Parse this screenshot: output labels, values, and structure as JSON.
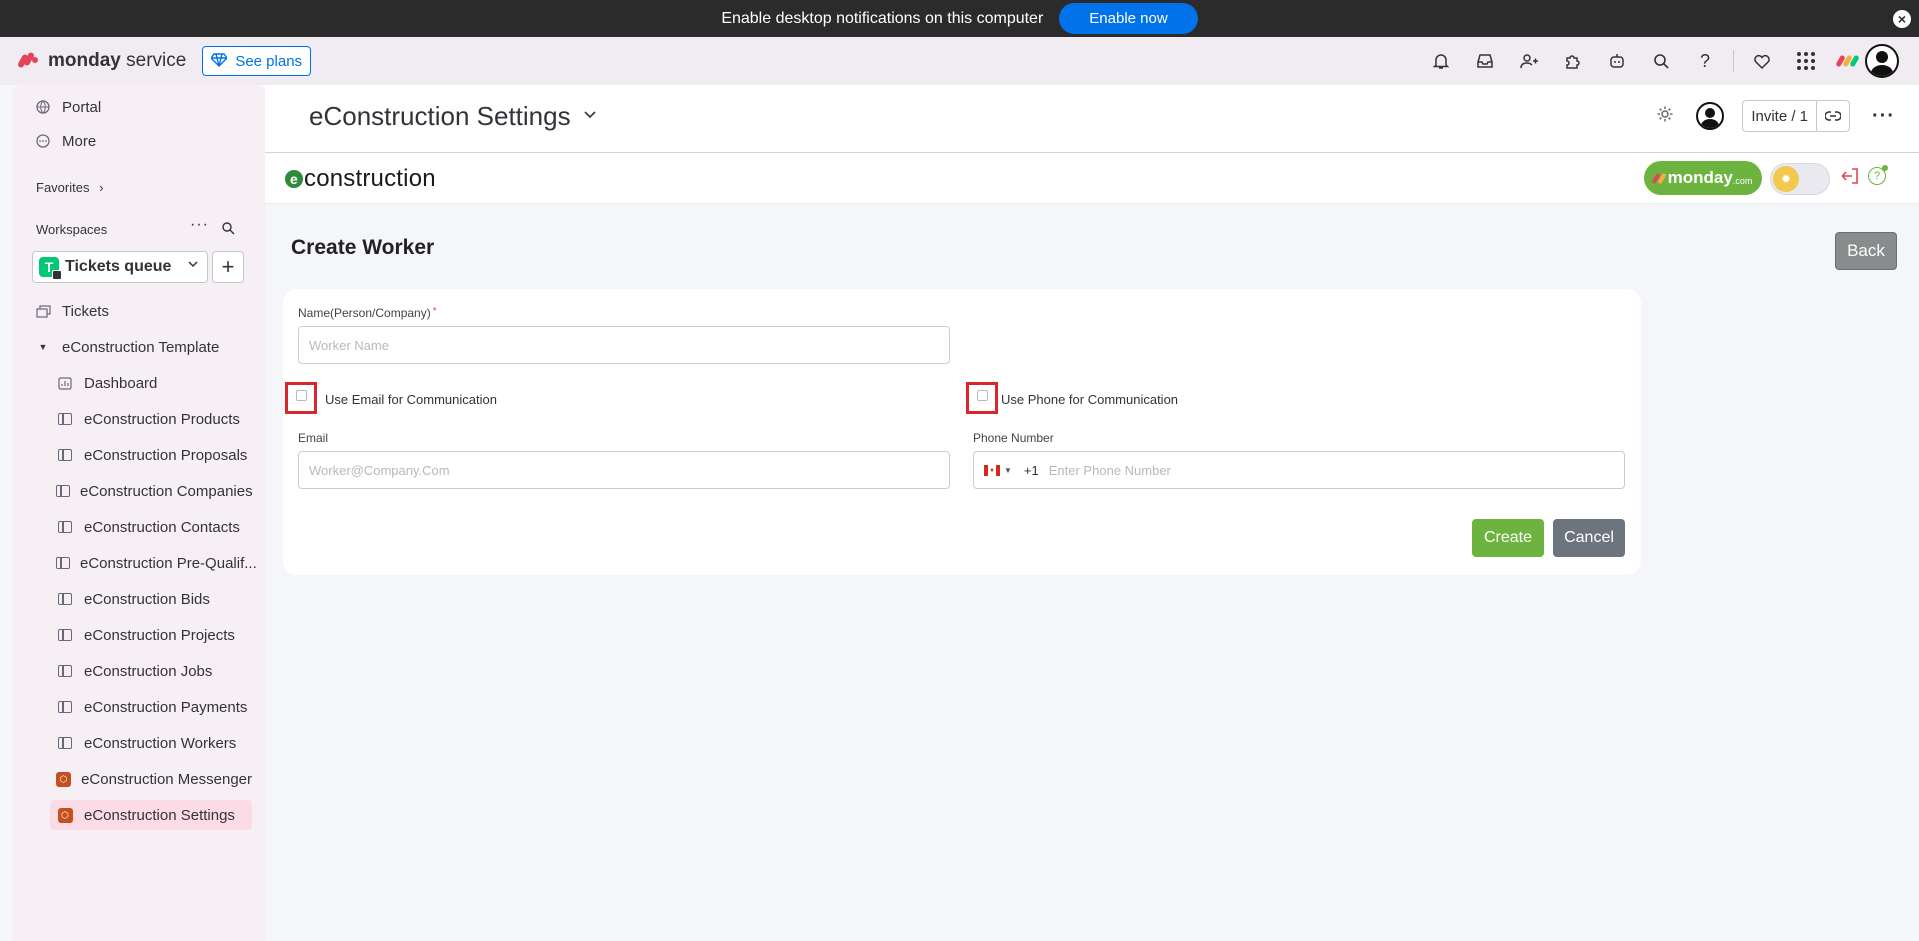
{
  "notification": {
    "text": "Enable desktop notifications on this computer",
    "enable_label": "Enable now",
    "close_label": "×"
  },
  "brand": {
    "name_bold": "monday",
    "name_rest": " service",
    "see_plans": "See plans"
  },
  "header_icons": [
    "bell-icon",
    "inbox-icon",
    "invite-members-icon",
    "apps-icon",
    "ai-bot-icon",
    "search-icon",
    "help-icon",
    "feedback-heart-icon",
    "app-launcher-icon"
  ],
  "sidebar": {
    "portal": "Portal",
    "more": "More",
    "favorites": "Favorites",
    "favorites_chevron": "›",
    "workspaces": "Workspaces",
    "workspace_badge": "T",
    "workspace_name": "Tickets queue",
    "tickets": "Tickets",
    "folder": "eConstruction Template",
    "items": [
      {
        "label": "Dashboard",
        "icon": "dashboard-icon"
      },
      {
        "label": "eConstruction Products",
        "icon": "board-icon"
      },
      {
        "label": "eConstruction Proposals",
        "icon": "board-icon"
      },
      {
        "label": "eConstruction Companies",
        "icon": "board-icon"
      },
      {
        "label": "eConstruction Contacts",
        "icon": "board-icon"
      },
      {
        "label": "eConstruction Pre-Qualif...",
        "icon": "board-icon"
      },
      {
        "label": "eConstruction Bids",
        "icon": "board-icon"
      },
      {
        "label": "eConstruction Projects",
        "icon": "board-icon"
      },
      {
        "label": "eConstruction Jobs",
        "icon": "board-icon"
      },
      {
        "label": "eConstruction Payments",
        "icon": "board-icon"
      },
      {
        "label": "eConstruction Workers",
        "icon": "board-icon"
      },
      {
        "label": "eConstruction Messenger",
        "icon": "app-icon"
      },
      {
        "label": "eConstruction Settings",
        "icon": "app-icon"
      }
    ]
  },
  "board": {
    "title": "eConstruction Settings",
    "invite_label": "Invite / 1"
  },
  "app": {
    "logo_text": "construction",
    "logo_letter": "e",
    "monday_pill": "monday",
    "monday_pill_suffix": ".com",
    "page_title": "Create Worker",
    "back_label": "Back",
    "form": {
      "name_label": "Name(Person/Company)",
      "name_required": "*",
      "name_placeholder": "Worker Name",
      "use_email_label": "Use Email for Communication",
      "use_phone_label": "Use Phone for Communication",
      "email_label": "Email",
      "email_placeholder": "Worker@Company.Com",
      "phone_label": "Phone Number",
      "phone_code": "+1",
      "phone_placeholder": "Enter Phone Number",
      "create_label": "Create",
      "cancel_label": "Cancel"
    }
  },
  "colors": {
    "accent_blue": "#0073ea",
    "app_green": "#6db33f",
    "cancel_gray": "#6c757d",
    "highlight_red": "#d9262c"
  }
}
